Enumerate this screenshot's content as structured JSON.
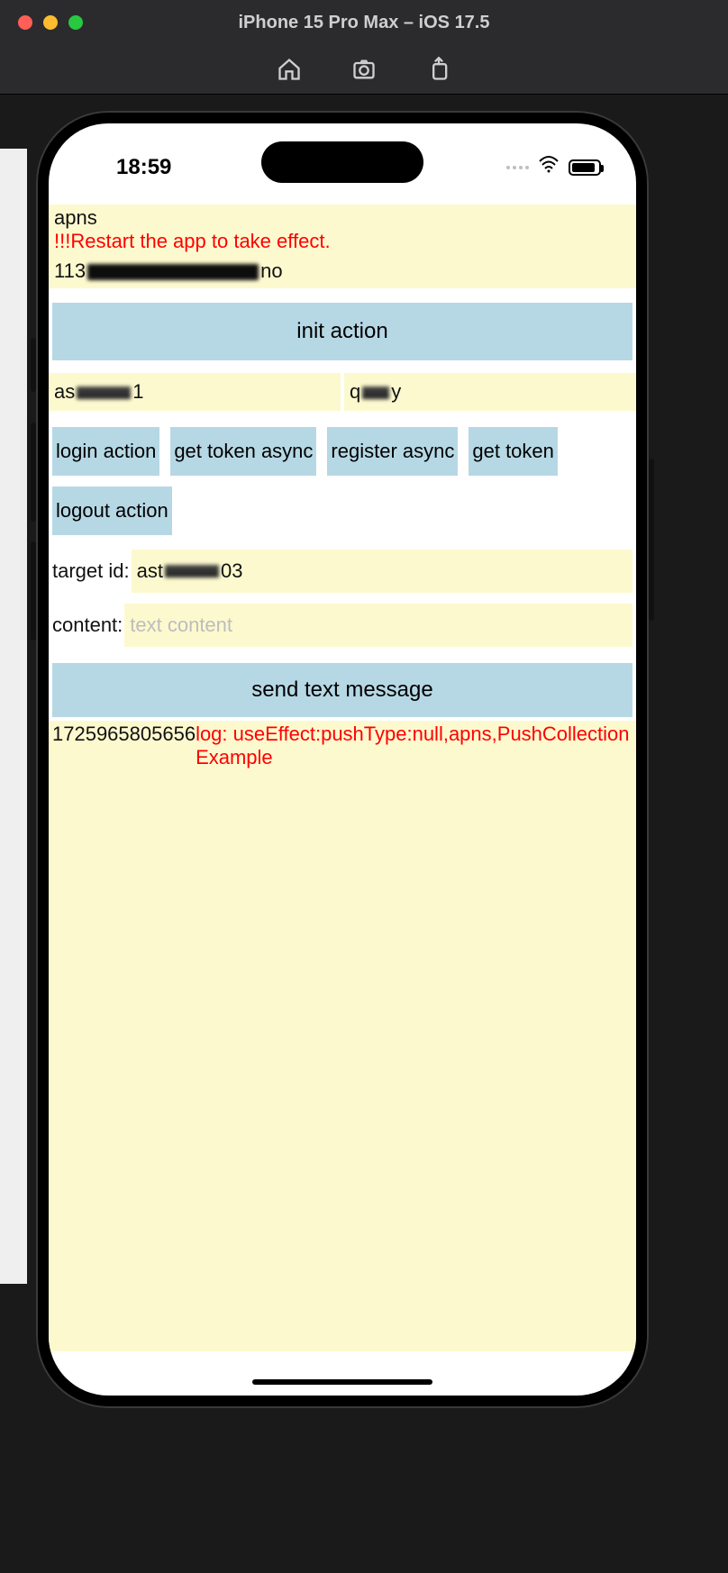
{
  "simulator": {
    "title": "iPhone 15 Pro Max – iOS 17.5"
  },
  "status": {
    "time": "18:59"
  },
  "app": {
    "pushType": "apns",
    "warning": "!!!Restart the app to take effect.",
    "appKeyPrefix": "113",
    "appKeySuffix": "no",
    "initButton": "init action",
    "userPrefix": "as",
    "userSuffix": "1",
    "passPrefix": "q",
    "passSuffix": "y",
    "buttons": {
      "login": "login action",
      "getTokenAsync": "get token async",
      "registerAsync": "register async",
      "getToken": "get token",
      "logout": "logout action"
    },
    "targetLabel": "target id:",
    "targetPrefix": "ast",
    "targetSuffix": "03",
    "contentLabel": "content:",
    "contentPlaceholder": "text content",
    "sendButton": "send text message",
    "log": {
      "timestamp": "1725965805656",
      "text": "log: useEffect:pushType:null,apns,PushCollectionExample"
    }
  }
}
